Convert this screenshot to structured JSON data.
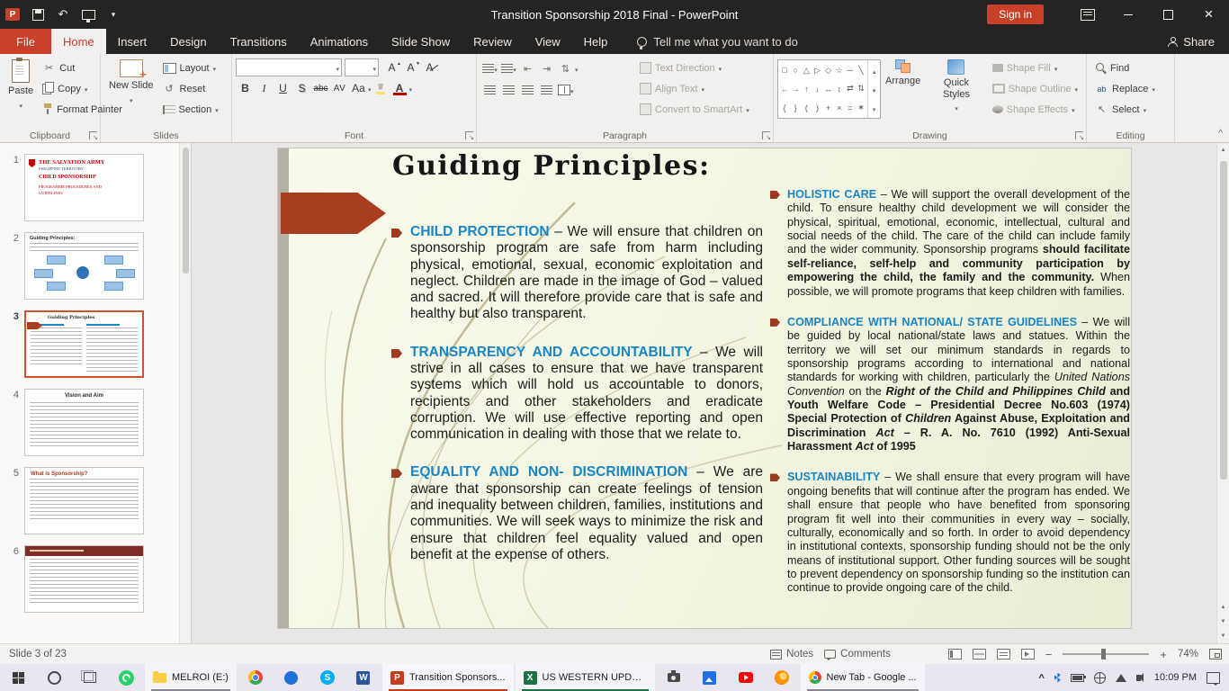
{
  "titlebar": {
    "title": "Transition Sponsorship 2018 Final - PowerPoint",
    "sign_in_label": "Sign in"
  },
  "ribbon": {
    "tabs": [
      "File",
      "Home",
      "Insert",
      "Design",
      "Transitions",
      "Animations",
      "Slide Show",
      "Review",
      "View",
      "Help"
    ],
    "selected_tab": "Home",
    "tell_me": "Tell me what you want to do",
    "share_label": "Share",
    "groups": {
      "clipboard": {
        "label": "Clipboard",
        "paste": "Paste",
        "cut": "Cut",
        "copy": "Copy",
        "format_painter": "Format Painter"
      },
      "slides": {
        "label": "Slides",
        "new_slide": "New Slide",
        "layout": "Layout",
        "reset": "Reset",
        "section": "Section"
      },
      "font": {
        "label": "Font",
        "bold": "B",
        "italic": "I",
        "underline": "U",
        "shadow": "S",
        "strikethrough": "abc",
        "char_spacing": "AV",
        "change_case": "Aa",
        "grow": "A",
        "shrink": "A",
        "clear": "A",
        "font_color": "A"
      },
      "paragraph": {
        "label": "Paragraph",
        "text_direction": "Text Direction",
        "align_text": "Align Text",
        "convert_smartart": "Convert to SmartArt"
      },
      "drawing": {
        "label": "Drawing",
        "arrange": "Arrange",
        "quick_styles": "Quick Styles",
        "shape_fill": "Shape Fill",
        "shape_outline": "Shape Outline",
        "shape_effects": "Shape Effects"
      },
      "editing": {
        "label": "Editing",
        "find": "Find",
        "replace": "Replace",
        "select": "Select"
      }
    }
  },
  "icons": {
    "shapes_palette": [
      "□",
      "○",
      "△",
      "▷",
      "◇",
      "☆",
      "─",
      "╲",
      "←",
      "→",
      "↑",
      "↓",
      "↔",
      "↕",
      "⇄",
      "⇅",
      "{",
      "}",
      "(",
      ")",
      "+",
      "×",
      "=",
      "∗"
    ]
  },
  "thumbnails": [
    {
      "n": "1",
      "line1": "THE SALVATION ARMY",
      "line2": "PHILIPPINE TERRITORY",
      "line3": "CHILD SPONSORSHIP",
      "line4": "PROGRAMME PROCEDURES AND GUIDELINES"
    },
    {
      "n": "2",
      "title": "Guiding Principles:"
    },
    {
      "n": "3",
      "title": "Guiding Principles"
    },
    {
      "n": "4",
      "title": "Vision and Aim"
    },
    {
      "n": "5",
      "title": "What is Sponsorship?"
    },
    {
      "n": "6",
      "title": ""
    }
  ],
  "slide": {
    "title": "Guiding Principles:",
    "left_bullets": [
      {
        "heading": "CHILD PROTECTION",
        "body": "– We will ensure that children on sponsorship program are safe from harm including physical, emotional, sexual, economic exploitation and neglect. Children are made in the image of God – valued and sacred. It will therefore provide care that is safe and healthy but also transparent."
      },
      {
        "heading": "TRANSPARENCY AND ACCOUNTABILITY",
        "body": "– We will strive in all cases to ensure that we have transparent systems which will hold us accountable to donors, recipients and other stakeholders and eradicate corruption. We will use effective reporting and open communication in dealing with those that we relate to."
      },
      {
        "heading": "EQUALITY AND NON- DISCRIMINATION",
        "body": "– We are aware that sponsorship can create feelings of tension and inequality between children, families, institutions and communities. We will seek ways to minimize the risk and ensure that children feel equality valued and open benefit at the expense of others."
      }
    ],
    "right_bullets": [
      {
        "heading": "HOLISTIC CARE",
        "body": "– We will support the overall development of the child. To ensure healthy child development we will consider the physical, spiritual, emotional, economic, intellectual, cultural and social needs of the child. The care of the child can include family and the wider community. Sponsorship programs <b>should facilitate self-reliance, self-help and community participation by empowering the child, the family and the community.</b> When possible, we will promote programs that keep children with families."
      },
      {
        "heading": "COMPLIANCE WITH NATIONAL/ STATE GUIDELINES",
        "body": "– We will be guided by local national/state laws and statues. Within the territory we will set our minimum standards in regards to sponsorship programs according to international and national standards for working with children, particularly the <i>United Nations Convention</i> on the <b><i>Right of the Child and Philippines Child</i> and Youth Welfare Code – Presidential Decree No.603 (1974) Special Protection of <i>Children</i> Against Abuse, Exploitation and Discrimination <i>Act</i> – R. A. No. 7610 (1992) Anti-Sexual Harassment <i>Act</i> of 1995</b>"
      },
      {
        "heading": "SUSTAINABILITY",
        "body": "– We shall ensure that every program will have ongoing benefits that will continue after the program has ended. We shall ensure that people who have benefited from sponsoring program fit well into their communities in every way – socially, culturally, economically and so forth. In order to avoid dependency in institutional contexts, sponsorship funding should not be the only means of institutional support. Other funding sources will be sought to prevent dependency on sponsorship funding so the institution can continue to provide ongoing care of the child."
      }
    ]
  },
  "statusbar": {
    "slide_indicator": "Slide 3 of 23",
    "notes": "Notes",
    "comments": "Comments",
    "zoom": "74%"
  },
  "taskbar": {
    "explorer_label": "MELROI (E:)",
    "powerpoint_label": "Transition Sponsors...",
    "excel_label": "US WESTERN UPDA...",
    "chrome_label": "New Tab - Google ...",
    "time": "10:09 PM"
  },
  "colors": {
    "accent_red": "#B7472A",
    "heading_blue": "#1886C5",
    "slide_background": "#EFF2DC",
    "arrow_red": "#A93D20"
  }
}
